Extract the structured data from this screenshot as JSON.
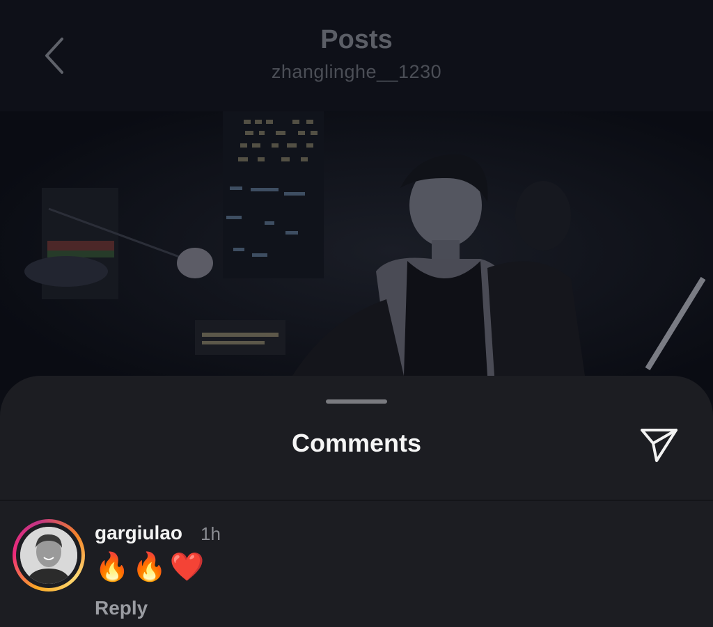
{
  "header": {
    "title": "Posts",
    "username": "zhanglinghe__1230"
  },
  "post": {
    "image_subject": "man-in-black-tank-top-night-city"
  },
  "comments_sheet": {
    "title": "Comments",
    "comments": [
      {
        "username": "gargiulao",
        "time": "1h",
        "text": "🔥🔥❤️",
        "reply_label": "Reply"
      }
    ]
  },
  "icons": {
    "back": "chevron-left-icon",
    "share": "paper-plane-icon"
  },
  "colors": {
    "background": "#0c0e15",
    "sheet": "#1c1d22",
    "title_dim": "#5b5e66",
    "ring_start": "#f9a825",
    "ring_end": "#c13584"
  }
}
